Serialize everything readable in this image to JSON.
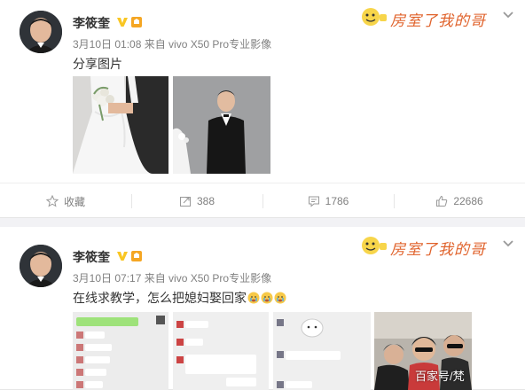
{
  "posts": [
    {
      "author": "李筱奎",
      "meta": "3月10日 01:08 来自 vivo X50 Pro专业影像",
      "text": "分享图片",
      "fan_badge_text": "房室了我的哥",
      "toolbar": {
        "favorite": "收藏",
        "repost": "388",
        "comment": "1786",
        "like": "22686"
      }
    },
    {
      "author": "李筱奎",
      "meta": "3月10日 07:17 来自 vivo X50 Pro专业影像",
      "text": "在线求教学，怎么把媳妇娶回家",
      "fan_badge_text": "房室了我的哥"
    }
  ],
  "watermark": "百家号/梵",
  "colors": {
    "verified": "#f9c623",
    "meta": "#808080",
    "icon": "#999999"
  }
}
